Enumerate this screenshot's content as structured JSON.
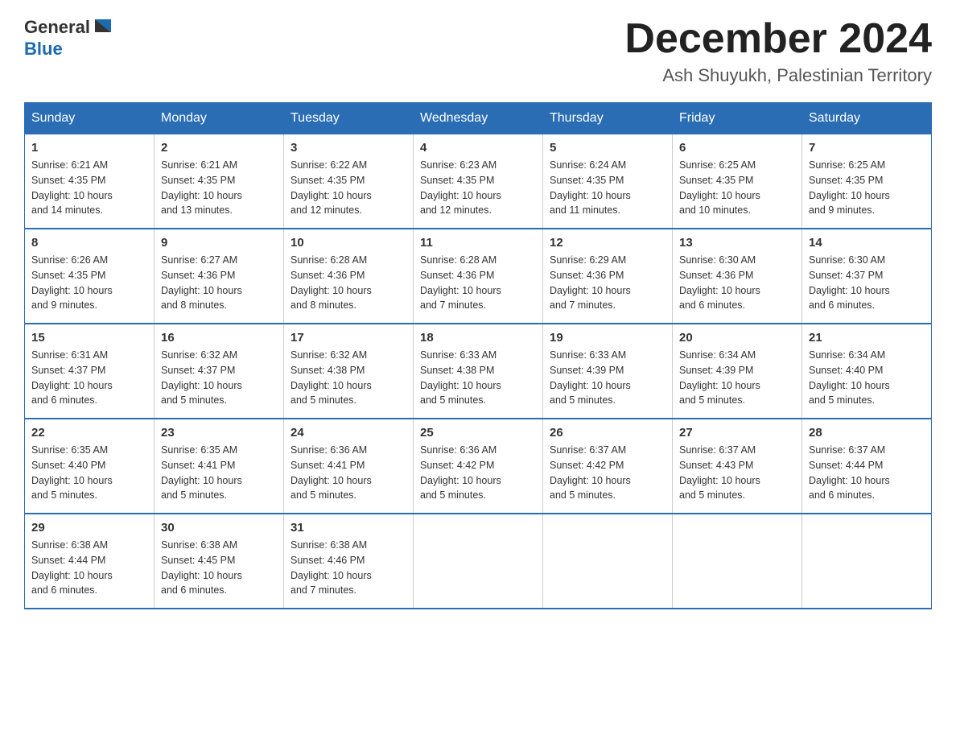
{
  "header": {
    "logo": {
      "general": "General",
      "blue": "Blue"
    },
    "month": "December 2024",
    "location": "Ash Shuyukh, Palestinian Territory"
  },
  "days_of_week": [
    "Sunday",
    "Monday",
    "Tuesday",
    "Wednesday",
    "Thursday",
    "Friday",
    "Saturday"
  ],
  "weeks": [
    [
      {
        "day": "1",
        "sunrise": "6:21 AM",
        "sunset": "4:35 PM",
        "daylight": "10 hours and 14 minutes."
      },
      {
        "day": "2",
        "sunrise": "6:21 AM",
        "sunset": "4:35 PM",
        "daylight": "10 hours and 13 minutes."
      },
      {
        "day": "3",
        "sunrise": "6:22 AM",
        "sunset": "4:35 PM",
        "daylight": "10 hours and 12 minutes."
      },
      {
        "day": "4",
        "sunrise": "6:23 AM",
        "sunset": "4:35 PM",
        "daylight": "10 hours and 12 minutes."
      },
      {
        "day": "5",
        "sunrise": "6:24 AM",
        "sunset": "4:35 PM",
        "daylight": "10 hours and 11 minutes."
      },
      {
        "day": "6",
        "sunrise": "6:25 AM",
        "sunset": "4:35 PM",
        "daylight": "10 hours and 10 minutes."
      },
      {
        "day": "7",
        "sunrise": "6:25 AM",
        "sunset": "4:35 PM",
        "daylight": "10 hours and 9 minutes."
      }
    ],
    [
      {
        "day": "8",
        "sunrise": "6:26 AM",
        "sunset": "4:35 PM",
        "daylight": "10 hours and 9 minutes."
      },
      {
        "day": "9",
        "sunrise": "6:27 AM",
        "sunset": "4:36 PM",
        "daylight": "10 hours and 8 minutes."
      },
      {
        "day": "10",
        "sunrise": "6:28 AM",
        "sunset": "4:36 PM",
        "daylight": "10 hours and 8 minutes."
      },
      {
        "day": "11",
        "sunrise": "6:28 AM",
        "sunset": "4:36 PM",
        "daylight": "10 hours and 7 minutes."
      },
      {
        "day": "12",
        "sunrise": "6:29 AM",
        "sunset": "4:36 PM",
        "daylight": "10 hours and 7 minutes."
      },
      {
        "day": "13",
        "sunrise": "6:30 AM",
        "sunset": "4:36 PM",
        "daylight": "10 hours and 6 minutes."
      },
      {
        "day": "14",
        "sunrise": "6:30 AM",
        "sunset": "4:37 PM",
        "daylight": "10 hours and 6 minutes."
      }
    ],
    [
      {
        "day": "15",
        "sunrise": "6:31 AM",
        "sunset": "4:37 PM",
        "daylight": "10 hours and 6 minutes."
      },
      {
        "day": "16",
        "sunrise": "6:32 AM",
        "sunset": "4:37 PM",
        "daylight": "10 hours and 5 minutes."
      },
      {
        "day": "17",
        "sunrise": "6:32 AM",
        "sunset": "4:38 PM",
        "daylight": "10 hours and 5 minutes."
      },
      {
        "day": "18",
        "sunrise": "6:33 AM",
        "sunset": "4:38 PM",
        "daylight": "10 hours and 5 minutes."
      },
      {
        "day": "19",
        "sunrise": "6:33 AM",
        "sunset": "4:39 PM",
        "daylight": "10 hours and 5 minutes."
      },
      {
        "day": "20",
        "sunrise": "6:34 AM",
        "sunset": "4:39 PM",
        "daylight": "10 hours and 5 minutes."
      },
      {
        "day": "21",
        "sunrise": "6:34 AM",
        "sunset": "4:40 PM",
        "daylight": "10 hours and 5 minutes."
      }
    ],
    [
      {
        "day": "22",
        "sunrise": "6:35 AM",
        "sunset": "4:40 PM",
        "daylight": "10 hours and 5 minutes."
      },
      {
        "day": "23",
        "sunrise": "6:35 AM",
        "sunset": "4:41 PM",
        "daylight": "10 hours and 5 minutes."
      },
      {
        "day": "24",
        "sunrise": "6:36 AM",
        "sunset": "4:41 PM",
        "daylight": "10 hours and 5 minutes."
      },
      {
        "day": "25",
        "sunrise": "6:36 AM",
        "sunset": "4:42 PM",
        "daylight": "10 hours and 5 minutes."
      },
      {
        "day": "26",
        "sunrise": "6:37 AM",
        "sunset": "4:42 PM",
        "daylight": "10 hours and 5 minutes."
      },
      {
        "day": "27",
        "sunrise": "6:37 AM",
        "sunset": "4:43 PM",
        "daylight": "10 hours and 5 minutes."
      },
      {
        "day": "28",
        "sunrise": "6:37 AM",
        "sunset": "4:44 PM",
        "daylight": "10 hours and 6 minutes."
      }
    ],
    [
      {
        "day": "29",
        "sunrise": "6:38 AM",
        "sunset": "4:44 PM",
        "daylight": "10 hours and 6 minutes."
      },
      {
        "day": "30",
        "sunrise": "6:38 AM",
        "sunset": "4:45 PM",
        "daylight": "10 hours and 6 minutes."
      },
      {
        "day": "31",
        "sunrise": "6:38 AM",
        "sunset": "4:46 PM",
        "daylight": "10 hours and 7 minutes."
      },
      null,
      null,
      null,
      null
    ]
  ],
  "labels": {
    "sunrise": "Sunrise:",
    "sunset": "Sunset:",
    "daylight": "Daylight:"
  }
}
